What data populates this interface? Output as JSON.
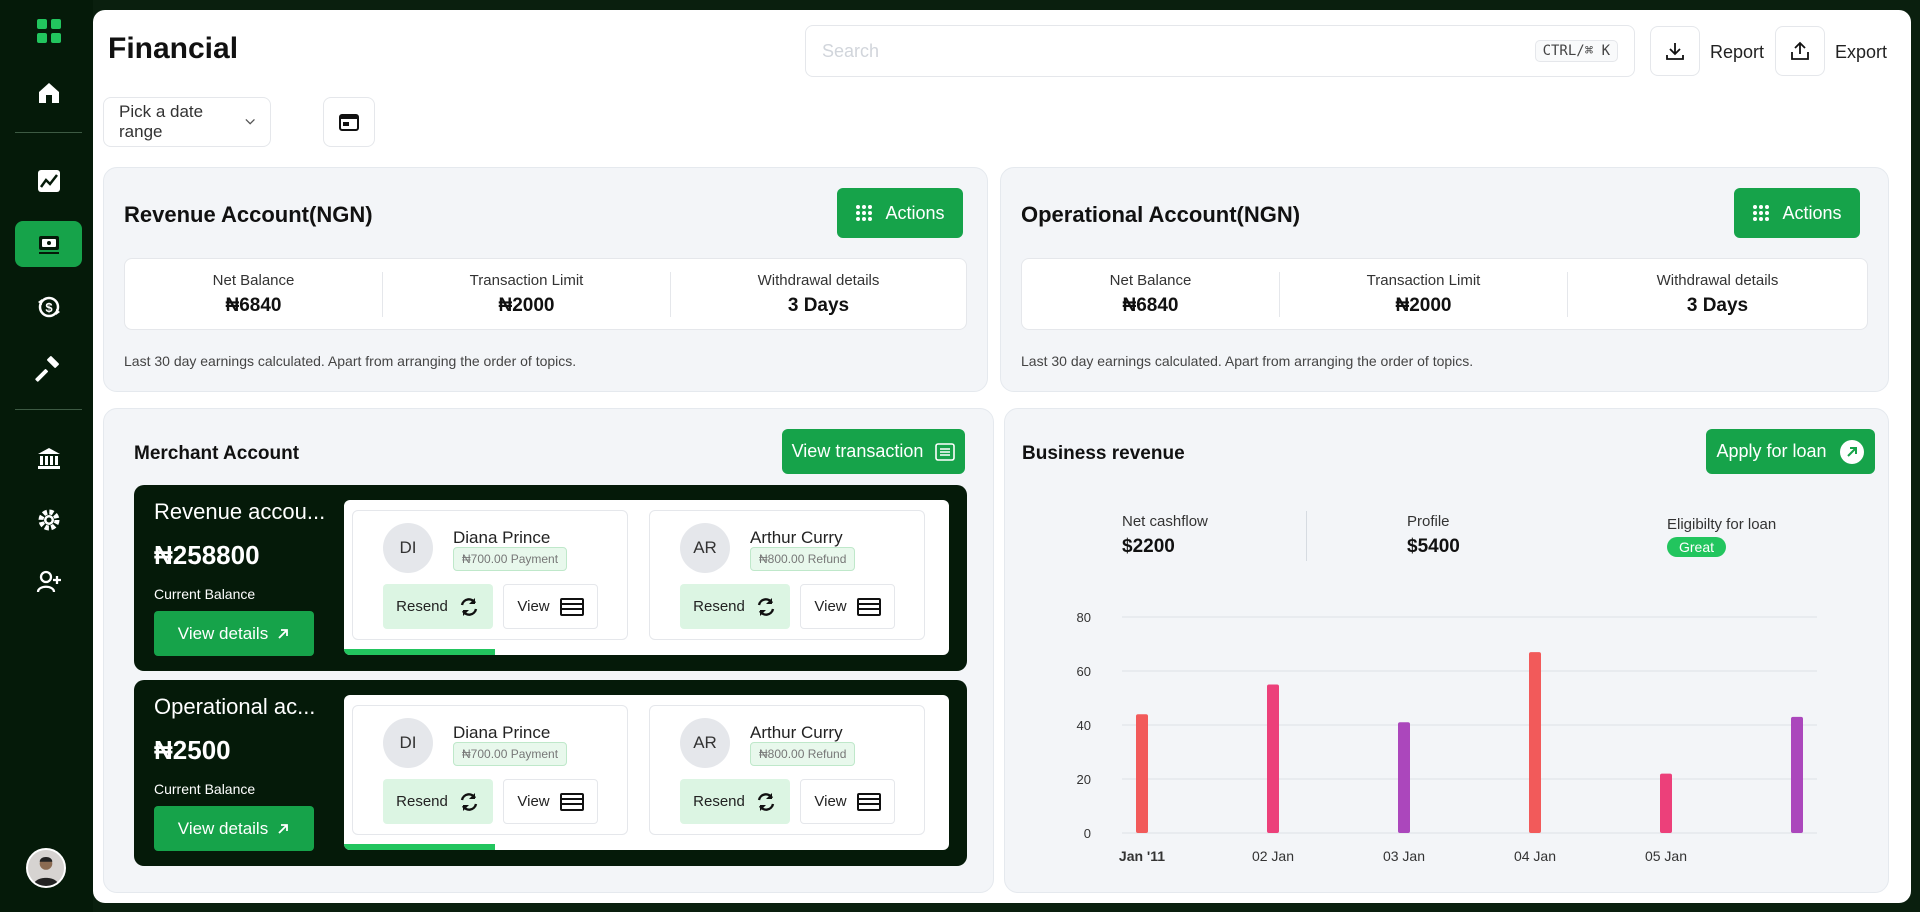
{
  "header": {
    "title": "Financial",
    "search_placeholder": "Search",
    "shortcut": "CTRL/⌘ K",
    "report_label": "Report",
    "export_label": "Export"
  },
  "filters": {
    "date_range_label": "Pick a date range"
  },
  "revenue_account": {
    "title": "Revenue Account(NGN)",
    "actions_label": "Actions",
    "net_balance_label": "Net Balance",
    "net_balance_value": "₦6840",
    "limit_label": "Transaction Limit",
    "limit_value": "₦2000",
    "withdrawal_label": "Withdrawal details",
    "withdrawal_value": "3 Days",
    "note": "Last 30 day earnings calculated. Apart from arranging the order of topics."
  },
  "operational_account": {
    "title": "Operational Account(NGN)",
    "actions_label": "Actions",
    "net_balance_label": "Net Balance",
    "net_balance_value": "₦6840",
    "limit_label": "Transaction Limit",
    "limit_value": "₦2000",
    "withdrawal_label": "Withdrawal details",
    "withdrawal_value": "3 Days",
    "note": "Last 30 day earnings calculated. Apart from arranging the order of topics."
  },
  "merchant": {
    "title": "Merchant Account",
    "view_transaction_label": "View transaction",
    "rows": [
      {
        "title": "Revenue accou...",
        "amount": "₦258800",
        "sub": "Current Balance",
        "button": "View details",
        "progress": 0.25,
        "transactions": [
          {
            "initials": "DI",
            "name": "Diana Prince",
            "tag": "₦700.00 Payment",
            "resend": "Resend",
            "view": "View"
          },
          {
            "initials": "AR",
            "name": "Arthur Curry",
            "tag": "₦800.00 Refund",
            "resend": "Resend",
            "view": "View"
          }
        ]
      },
      {
        "title": "Operational ac...",
        "amount": "₦2500",
        "sub": "Current Balance",
        "button": "View details",
        "progress": 0.25,
        "transactions": [
          {
            "initials": "DI",
            "name": "Diana Prince",
            "tag": "₦700.00 Payment",
            "resend": "Resend",
            "view": "View"
          },
          {
            "initials": "AR",
            "name": "Arthur Curry",
            "tag": "₦800.00 Refund",
            "resend": "Resend",
            "view": "View"
          }
        ]
      }
    ]
  },
  "business": {
    "title": "Business revenue",
    "loan_label": "Apply for loan",
    "net_cashflow_label": "Net cashflow",
    "net_cashflow_value": "$2200",
    "profile_label": "Profile",
    "profile_value": "$5400",
    "eligibility_label": "Eligibilty for loan",
    "eligibility_badge": "Great"
  },
  "chart_data": {
    "type": "bar",
    "x_tick_labels": [
      "Jan '11",
      "02 Jan",
      "03 Jan",
      "04 Jan",
      "05 Jan"
    ],
    "values": [
      44,
      55,
      41,
      67,
      22,
      43
    ],
    "colors": [
      "#f25a5a",
      "#ec407a",
      "#ab47bc",
      "#f25a5a",
      "#ec407a",
      "#ab47bc"
    ],
    "yticks": [
      0,
      20,
      40,
      60,
      80
    ],
    "ylim": [
      0,
      80
    ],
    "grid": true
  }
}
